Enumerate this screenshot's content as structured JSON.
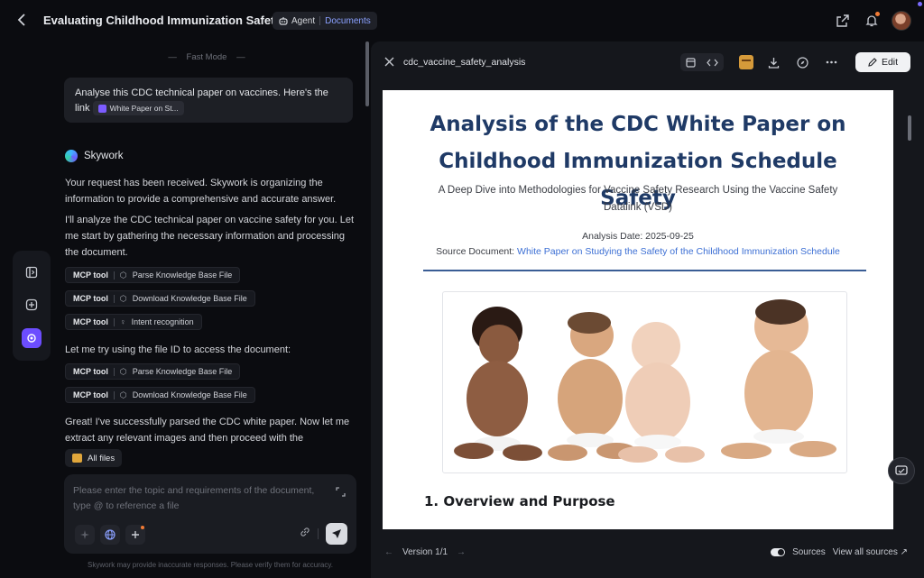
{
  "header": {
    "title": "Evaluating Childhood Immunization Safety",
    "agent_label": "Agent",
    "mode_label": "Documents"
  },
  "chat": {
    "fast_mode": "Fast Mode",
    "user_message": "Analyse this CDC technical paper on vaccines. Here's the link",
    "user_chip": "White Paper on St...",
    "assistant_name": "Skywork",
    "p1": "Your request has been received. Skywork is organizing the information to provide a comprehensive and accurate answer.",
    "p2": "I'll analyze the CDC technical paper on vaccine safety for you. Let me start by gathering the necessary information and processing the document.",
    "tools_a": [
      {
        "tag": "MCP tool",
        "label": "Parse Knowledge Base File",
        "icon": "cube-icon"
      },
      {
        "tag": "MCP tool",
        "label": "Download Knowledge Base File",
        "icon": "cube-icon"
      },
      {
        "tag": "MCP tool",
        "label": "Intent recognition",
        "icon": "bulb-icon"
      }
    ],
    "p3": "Let me try using the file ID to access the document:",
    "tools_b": [
      {
        "tag": "MCP tool",
        "label": "Parse Knowledge Base File",
        "icon": "cube-icon"
      },
      {
        "tag": "MCP tool",
        "label": "Download Knowledge Base File",
        "icon": "cube-icon"
      }
    ],
    "p4": "Great! I've successfully parsed the CDC white paper. Now let me extract any relevant images and then proceed with the",
    "all_files": "All files",
    "composer_placeholder": "Please enter the topic and requirements of the document, type @ to reference a file",
    "disclaimer": "Skywork may provide inaccurate responses. Please verify them for accuracy."
  },
  "panel": {
    "file_name": "cdc_vaccine_safety_analysis",
    "edit_label": "Edit",
    "version_label": "Version 1/1",
    "sources_label": "Sources",
    "view_sources_label": "View all sources"
  },
  "document": {
    "title": "Analysis of the CDC White Paper on Childhood Immunization Schedule Safety",
    "subtitle": "A Deep Dive into Methodologies for Vaccine Safety Research Using the Vaccine Safety Datalink (VSD)",
    "analysis_date": "Analysis Date: 2025-09-25",
    "source_prefix": "Source Document: ",
    "source_link": "White Paper on Studying the Safety of the Childhood Immunization Schedule",
    "section_heading": "1. Overview and Purpose"
  },
  "colors": {
    "accent": "#6c4dff",
    "doc_title": "#1f3a66",
    "link": "#3c6fd4"
  }
}
